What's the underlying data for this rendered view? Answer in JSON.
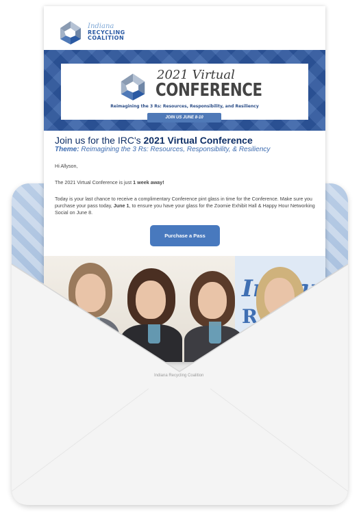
{
  "logo": {
    "line1": "Indiana",
    "line2": "RECYCLING",
    "line3": "COALITION"
  },
  "banner": {
    "year": "2021 Virtual",
    "title": "CONFERENCE",
    "subtitle": "Reimagining the 3 Rs: Resources, Responsibility, and Resiliency",
    "dates": "JOIN US JUNE 8-10"
  },
  "email": {
    "headline_prefix": "Join us for the IRC's ",
    "headline_bold": "2021 Virtual Conference",
    "theme_label": "Theme:",
    "theme_text": " Reimagining the 3 Rs: Resources, Responsibility, & Resiliency",
    "greeting": "Hi Allyson,",
    "p1_prefix": "The 2021 Virtual Conference is just ",
    "p1_bold": "1 week away!",
    "p2_part1": "Today is your last chance to receive a complimentary Conference pint glass in time for the Conference. Make sure you purchase your pass today, ",
    "p2_bold": "June 1",
    "p2_part2": ", to ensure you have your glass for the Zoomie Exhibit Hall & Happy Hour Networking Social on June 8.",
    "cta": "Purchase a Pass"
  },
  "photo": {
    "sign_line1": "Indiana",
    "sign_line2": "RECY"
  },
  "envelope": {
    "return_address": "Indiana Recycling Coalition"
  },
  "colors": {
    "brand_blue": "#2f5aa3",
    "cta_blue": "#4879be",
    "headline_navy": "#0f2f66",
    "theme_blue": "#3c6bb0"
  }
}
